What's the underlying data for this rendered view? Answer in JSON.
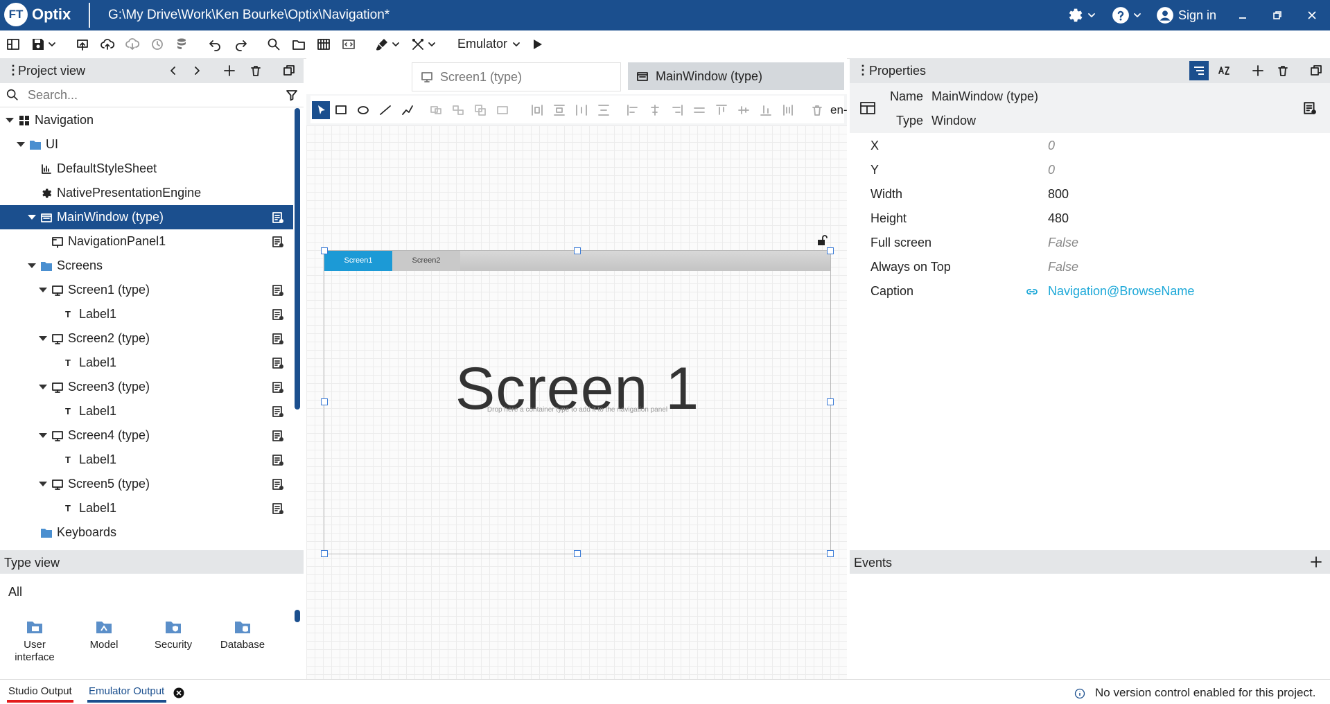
{
  "app": {
    "logo_text": "FT",
    "name": "Optix",
    "path": "G:\\My Drive\\Work\\Ken Bourke\\Optix\\Navigation*",
    "sign_in": "Sign in"
  },
  "toolbar": {
    "emulator_label": "Emulator"
  },
  "project_view": {
    "title": "Project view",
    "search_placeholder": "Search...",
    "tree": [
      {
        "label": "Navigation",
        "icon": "grid-icon"
      },
      {
        "label": "UI",
        "icon": "folder-icon"
      },
      {
        "label": "DefaultStyleSheet",
        "icon": "stylesheet-icon"
      },
      {
        "label": "NativePresentationEngine",
        "icon": "gear-icon"
      },
      {
        "label": "MainWindow (type)",
        "icon": "window-icon"
      },
      {
        "label": "NavigationPanel1",
        "icon": "navigation-panel-icon"
      },
      {
        "label": "Screens",
        "icon": "folder-icon"
      },
      {
        "label": "Screen1 (type)",
        "icon": "monitor-icon"
      },
      {
        "label": "Label1",
        "icon": "text-icon"
      },
      {
        "label": "Screen2 (type)",
        "icon": "monitor-icon"
      },
      {
        "label": "Label1",
        "icon": "text-icon"
      },
      {
        "label": "Screen3 (type)",
        "icon": "monitor-icon"
      },
      {
        "label": "Label1",
        "icon": "text-icon"
      },
      {
        "label": "Screen4 (type)",
        "icon": "monitor-icon"
      },
      {
        "label": "Label1",
        "icon": "text-icon"
      },
      {
        "label": "Screen5 (type)",
        "icon": "monitor-icon"
      },
      {
        "label": "Label1",
        "icon": "text-icon"
      },
      {
        "label": "Keyboards",
        "icon": "folder-icon"
      }
    ]
  },
  "type_view": {
    "title": "Type view",
    "filter": "All",
    "items": [
      {
        "label": "User\ninterface"
      },
      {
        "label": "Model"
      },
      {
        "label": "Security"
      },
      {
        "label": "Database"
      }
    ]
  },
  "editor": {
    "tabs": [
      {
        "label": "Screen1 (type)"
      },
      {
        "label": "MainWindow (type)"
      }
    ],
    "locale": "en-",
    "nav_tabs": [
      "Screen1",
      "Screen2"
    ],
    "canvas_text": "Screen 1",
    "hint": "Drop here a container type to add it to the navigation panel"
  },
  "properties": {
    "title": "Properties",
    "name_label": "Name",
    "name_value": "MainWindow (type)",
    "type_label": "Type",
    "type_value": "Window",
    "rows": [
      {
        "label": "X",
        "value": "0"
      },
      {
        "label": "Y",
        "value": "0"
      },
      {
        "label": "Width",
        "value": "800"
      },
      {
        "label": "Height",
        "value": "480"
      },
      {
        "label": "Full screen",
        "value": "False"
      },
      {
        "label": "Always on Top",
        "value": "False"
      },
      {
        "label": "Caption",
        "value": "Navigation@BrowseName"
      }
    ]
  },
  "events": {
    "title": "Events"
  },
  "status": {
    "studio_output": "Studio Output",
    "emulator_output": "Emulator Output",
    "message": "No version control enabled for this project."
  },
  "colors": {
    "brand": "#1b4f8e",
    "accent": "#1c9ad6",
    "link": "#1ca8d8",
    "error_underline": "#e31c1c"
  }
}
